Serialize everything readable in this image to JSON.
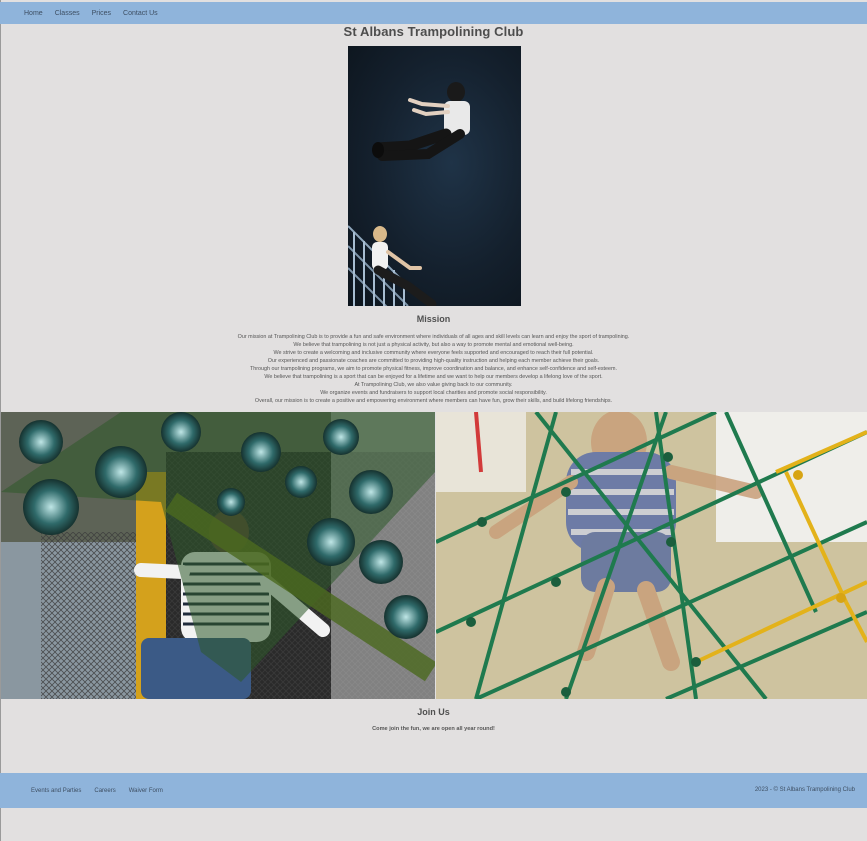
{
  "nav": {
    "items": [
      {
        "label": "Home"
      },
      {
        "label": "Classes"
      },
      {
        "label": "Prices"
      },
      {
        "label": "Contact Us"
      }
    ]
  },
  "page": {
    "title": "St Albans Trampolining Club"
  },
  "mission": {
    "heading": "Mission",
    "lines": [
      "Our mission at Trampolining Club is to provide a fun and safe environment where individuals of all ages and skill levels can learn and enjoy the sport of trampolining.",
      "We believe that trampolining is not just a physical activity, but also a way to promote mental and emotional well-being.",
      "We strive to create a welcoming and inclusive community where everyone feels supported and encouraged to reach their full potential.",
      "Our experienced and passionate coaches are committed to providing high-quality instruction and helping each member achieve their goals.",
      "Through our trampolining programs, we aim to promote physical fitness, improve coordination and balance, and enhance self-confidence and self-esteem.",
      "We believe that trampolining is a sport that can be enjoyed for a lifetime and we want to help our members develop a lifelong love of the sport.",
      "At Trampolining Club, we also value giving back to our community.",
      "We organize events and fundraisers to support local charities and promote social responsibility.",
      "Overall, our mission is to create a positive and empowering environment where members can have fun, grow their skills, and build lifelong friendships."
    ]
  },
  "join": {
    "heading": "Join Us",
    "text": "Come join the fun, we are open all year round!"
  },
  "footer": {
    "links": [
      {
        "label": "Events and Parties"
      },
      {
        "label": "Careers"
      },
      {
        "label": "Waiver Form"
      }
    ],
    "copyright": "2023 - © St Albans Trampolining Club"
  },
  "colors": {
    "nav_bg": "#8fb4db",
    "page_bg": "#e2e0e0"
  }
}
